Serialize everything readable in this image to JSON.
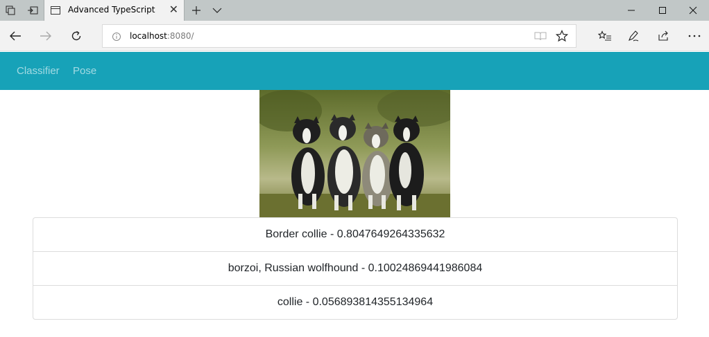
{
  "browser": {
    "tab_title": "Advanced TypeScript",
    "url_host": "localhost",
    "url_rest": ":8080/",
    "icons": {
      "tab_actions": "tabs-aside-icon",
      "set_aside": "set-tabs-aside-icon",
      "page": "page-icon",
      "close": "close-icon",
      "new_tab": "plus-icon",
      "tab_list": "chevron-down-icon",
      "back": "back-arrow-icon",
      "forward": "forward-arrow-icon",
      "refresh": "refresh-icon",
      "info": "info-icon",
      "reading_view": "book-icon",
      "favorite": "star-icon",
      "favorites_hub": "favorites-list-icon",
      "notes": "pen-icon",
      "share": "share-icon",
      "more": "ellipsis-icon"
    }
  },
  "app_nav": {
    "color": "#17a2b8",
    "links": [
      {
        "label": "Classifier"
      },
      {
        "label": "Pose"
      }
    ]
  },
  "results": [
    {
      "text": "Border collie - 0.8047649264335632"
    },
    {
      "text": "borzoi, Russian wolfhound - 0.10024869441986084"
    },
    {
      "text": "collie - 0.056893814355134964"
    }
  ]
}
